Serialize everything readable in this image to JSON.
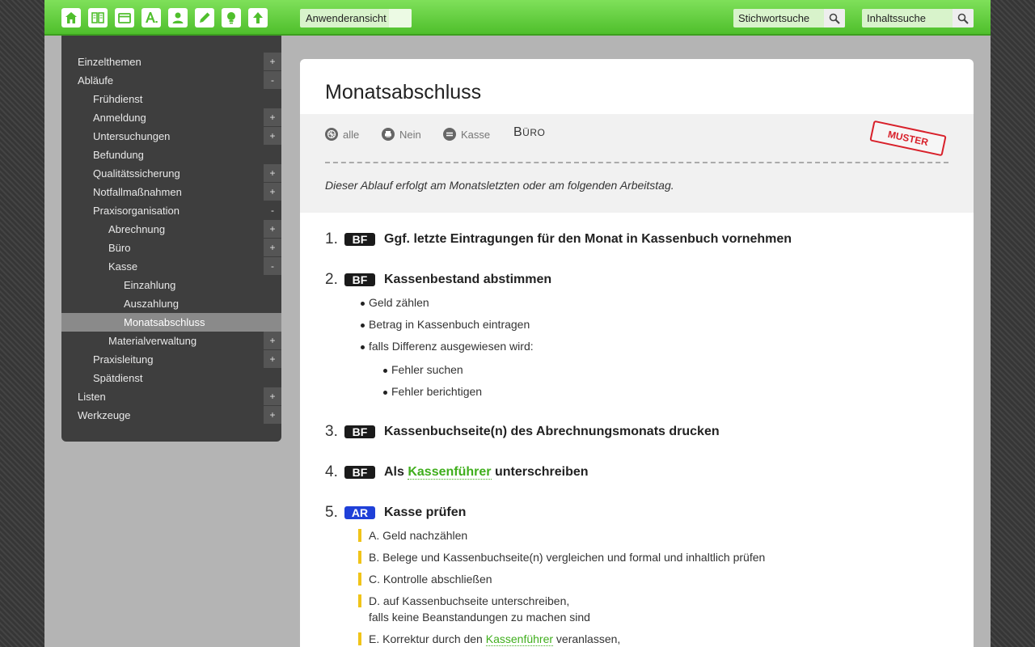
{
  "toolbar": {
    "icons": [
      "home-icon",
      "book-icon",
      "folder-icon",
      "font-icon",
      "user-icon",
      "pencil-icon",
      "lightbulb-icon",
      "arrow-up-icon"
    ],
    "view_label": "Anwenderansicht",
    "keyword_search": "Stichwortsuche",
    "content_search": "Inhaltssuche"
  },
  "sidebar": {
    "items": [
      {
        "label": "Einzelthemen",
        "toggle": "+"
      },
      {
        "label": "Abläufe",
        "toggle": "-"
      },
      {
        "label": "Frühdienst",
        "toggle": ""
      },
      {
        "label": "Anmeldung",
        "toggle": "+"
      },
      {
        "label": "Untersuchungen",
        "toggle": "+"
      },
      {
        "label": "Befundung",
        "toggle": ""
      },
      {
        "label": "Qualitätssicherung",
        "toggle": "+"
      },
      {
        "label": "Notfallmaßnahmen",
        "toggle": "+"
      },
      {
        "label": "Praxisorganisation",
        "toggle": "-"
      },
      {
        "label": "Abrechnung",
        "toggle": "+"
      },
      {
        "label": "Büro",
        "toggle": "+"
      },
      {
        "label": "Kasse",
        "toggle": "-"
      },
      {
        "label": "Einzahlung",
        "toggle": ""
      },
      {
        "label": "Auszahlung",
        "toggle": ""
      },
      {
        "label": "Monatsabschluss",
        "toggle": ""
      },
      {
        "label": "Materialverwaltung",
        "toggle": "+"
      },
      {
        "label": "Praxisleitung",
        "toggle": "+"
      },
      {
        "label": "Spätdienst",
        "toggle": ""
      },
      {
        "label": "Listen",
        "toggle": "+"
      },
      {
        "label": "Werkzeuge",
        "toggle": "+"
      }
    ]
  },
  "main": {
    "title": "Monatsabschluss",
    "meta": {
      "alle": "alle",
      "nein": "Nein",
      "kasse": "Kasse",
      "buero_first": "B",
      "buero_rest": "ÜRO"
    },
    "stamp": "MUSTER",
    "intro": "Dieser Ablauf erfolgt am Monatsletzten oder am folgenden Arbeitstag.",
    "steps": [
      {
        "num": "1.",
        "badge": "BF",
        "title": "Ggf. letzte Eintragungen für den Monat in Kassenbuch vornehmen"
      },
      {
        "num": "2.",
        "badge": "BF",
        "title": "Kassenbestand abstimmen",
        "bullets": [
          "Geld zählen",
          "Betrag in Kassenbuch eintragen",
          "falls Differenz ausgewiesen wird:"
        ],
        "subbullets": [
          "Fehler suchen",
          "Fehler berichtigen"
        ]
      },
      {
        "num": "3.",
        "badge": "BF",
        "title": "Kassenbuchseite(n) des Abrechnungsmonats drucken"
      },
      {
        "num": "4.",
        "badge": "BF",
        "title_pre": "Als ",
        "title_link": "Kassenführer",
        "title_post": " unterschreiben"
      },
      {
        "num": "5.",
        "badge": "AR",
        "title": "Kasse prüfen",
        "items": [
          {
            "text": "A. Geld nachzählen"
          },
          {
            "text": "B. Belege und Kassenbuchseite(n) vergleichen und formal und inhaltlich prüfen"
          },
          {
            "text": "C. Kontrolle abschließen"
          },
          {
            "text": "D.  auf Kassenbuchseite unterschreiben,",
            "text2": "falls keine Beanstandungen zu machen sind"
          },
          {
            "pre": "E.  Korrektur durch den ",
            "link": "Kassenführer",
            "post": " veranlassen,"
          }
        ]
      }
    ]
  }
}
